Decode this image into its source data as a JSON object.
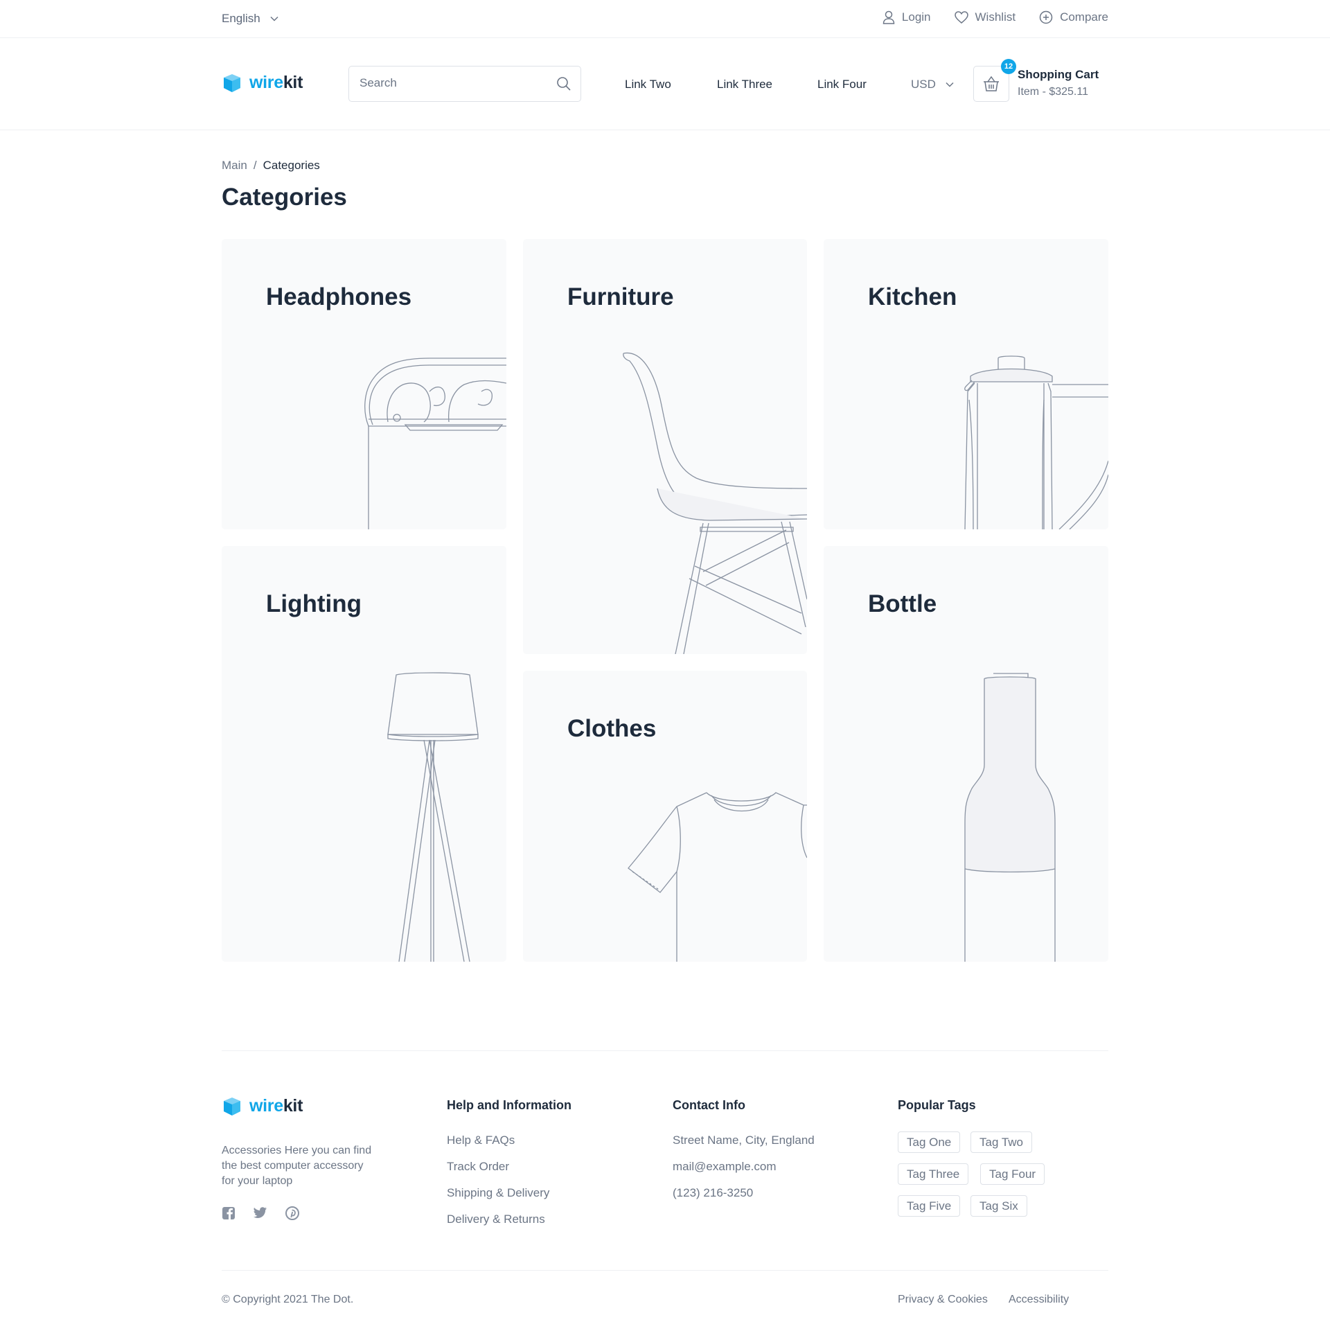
{
  "topbar": {
    "language": "English",
    "login": "Login",
    "wishlist": "Wishlist",
    "compare": "Compare"
  },
  "header": {
    "logo_part1": "wire",
    "logo_part2": "kit",
    "search_placeholder": "Search",
    "nav": [
      "Link Two",
      "Link Three",
      "Link Four"
    ],
    "currency": "USD",
    "cart_count": "12",
    "cart_title": "Shopping Cart",
    "cart_summary": "Item - $325.11"
  },
  "breadcrumb": {
    "root": "Main",
    "separator": "/",
    "current": "Categories"
  },
  "page_title": "Categories",
  "categories": [
    {
      "name": "Headphones",
      "illustration": "earbuds-case-icon"
    },
    {
      "name": "Furniture",
      "illustration": "chair-icon"
    },
    {
      "name": "Kitchen",
      "illustration": "kettle-icon"
    },
    {
      "name": "Lighting",
      "illustration": "floor-lamp-icon"
    },
    {
      "name": "Clothes",
      "illustration": "tshirt-icon"
    },
    {
      "name": "Bottle",
      "illustration": "bottle-icon"
    }
  ],
  "footer": {
    "description": "Accessories Here you can find the best computer accessory for your laptop",
    "social": [
      "facebook-icon",
      "twitter-icon",
      "pinterest-icon"
    ],
    "help_title": "Help and Information",
    "help_links": [
      "Help & FAQs",
      "Track Order",
      "Shipping & Delivery",
      "Delivery & Returns"
    ],
    "contact_title": "Contact Info",
    "contact": [
      "Street Name, City, England",
      "mail@example.com",
      "(123) 216-3250"
    ],
    "tags_title": "Popular Tags",
    "tags": [
      "Tag One",
      "Tag Two",
      "Tag Three",
      "Tag Four",
      "Tag Five",
      "Tag Six"
    ],
    "copyright": "© Copyright 2021 The Dot.",
    "bottom_links": [
      "Privacy & Cookies",
      "Accessibility"
    ]
  },
  "colors": {
    "accent": "#10a6e8",
    "text": "#1e2b3c",
    "muted": "#6b7585",
    "card_bg": "#f9fafb",
    "border": "#dde1e7"
  }
}
